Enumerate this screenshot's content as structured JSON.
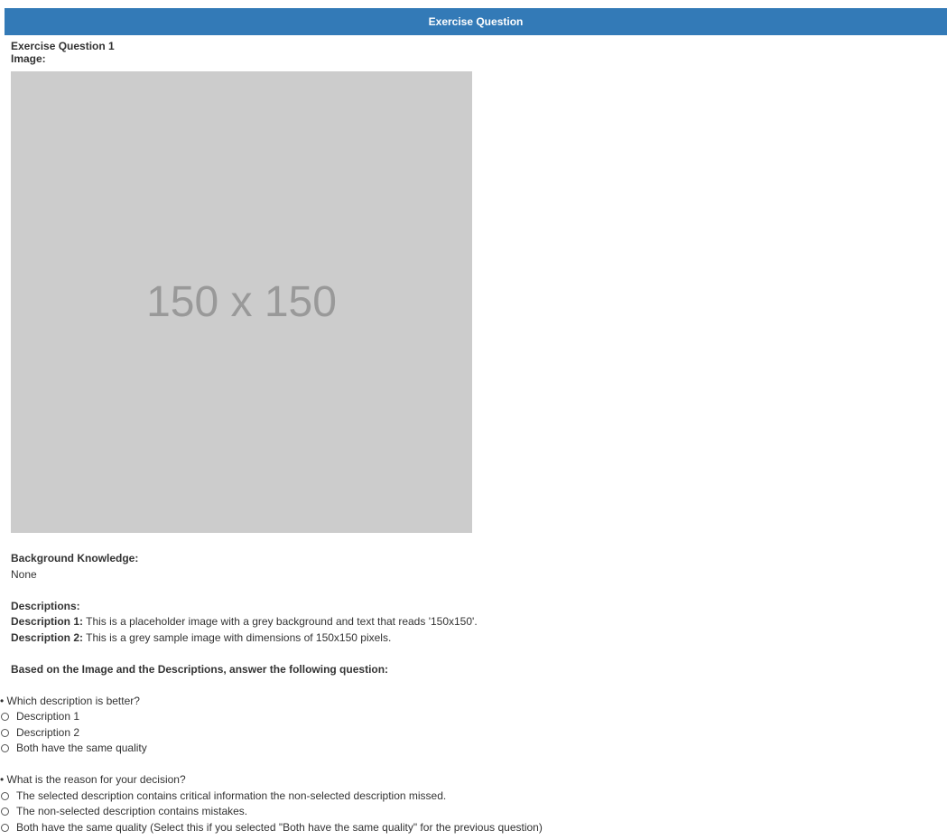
{
  "header": {
    "title": "Exercise Question"
  },
  "question": {
    "title": "Exercise Question 1",
    "image_label": "Image:",
    "placeholder_text": "150 x 150"
  },
  "background": {
    "label": "Background Knowledge:",
    "value": "None"
  },
  "descriptions": {
    "label": "Descriptions:",
    "items": [
      {
        "label": "Description 1:",
        "text": "This is a placeholder image with a grey background and text that reads '150x150'."
      },
      {
        "label": "Description 2:",
        "text": "This is a grey sample image with dimensions of 150x150 pixels."
      }
    ]
  },
  "instruction": "Based on the Image and the Descriptions, answer the following question:",
  "q1": {
    "prompt": "• Which description is better?",
    "options": [
      "Description 1",
      "Description 2",
      "Both have the same quality"
    ]
  },
  "q2": {
    "prompt": "• What is the reason for your decision?",
    "options": [
      "The selected description contains critical information the non-selected description missed.",
      "The non-selected description contains mistakes.",
      "Both have the same quality (Select this if you selected \"Both have the same quality\" for the previous question)"
    ]
  },
  "colors": {
    "header_bg": "#337ab7",
    "placeholder_bg": "#cccccc"
  }
}
